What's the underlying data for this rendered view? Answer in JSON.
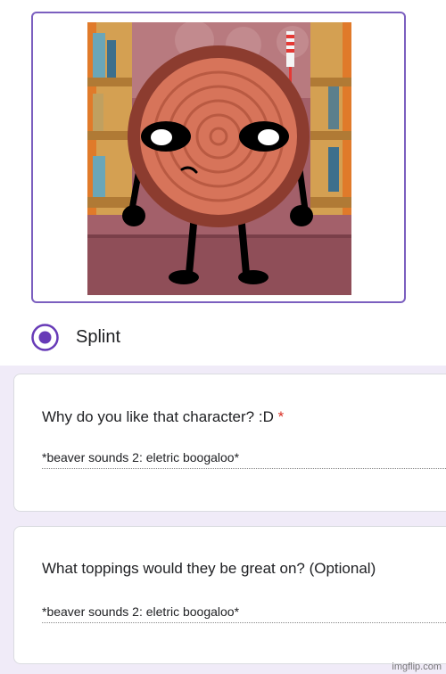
{
  "option": {
    "label": "Splint",
    "selected": true
  },
  "questions": [
    {
      "title": "Why do you like that character? :D",
      "required_mark": "*",
      "answer": "*beaver sounds 2: eletric boogaloo*"
    },
    {
      "title": "What toppings would they be great on? (Optional)",
      "answer": "*beaver sounds 2: eletric boogaloo*"
    }
  ],
  "watermark": "imgflip.com",
  "colors": {
    "accent": "#673ab7",
    "required": "#d93025",
    "background": "#f0ebf8"
  },
  "icons": {
    "radio": "radio-selected-icon"
  }
}
